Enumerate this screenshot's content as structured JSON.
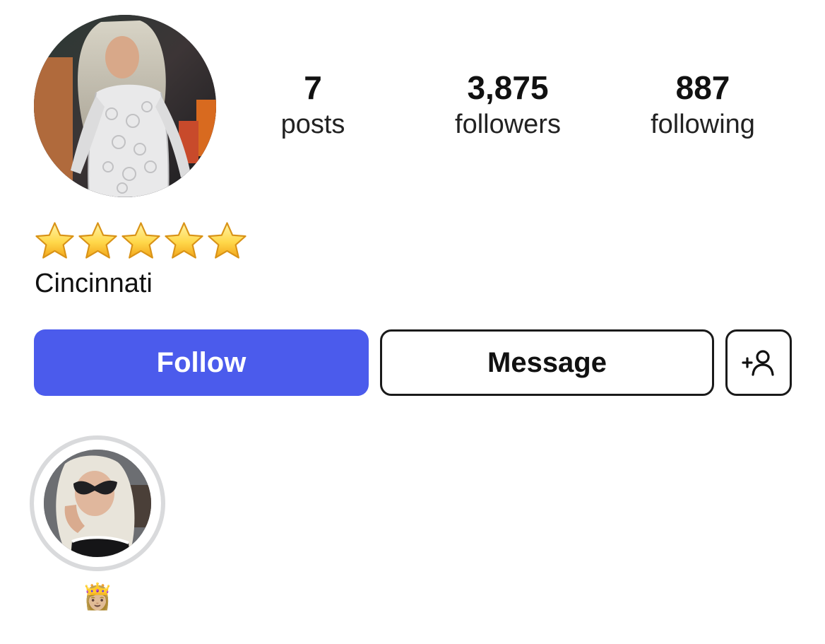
{
  "profile": {
    "avatar_icon": "profile-photo",
    "stats": {
      "posts": {
        "value": "7",
        "label": "posts"
      },
      "followers": {
        "value": "3,875",
        "label": "followers"
      },
      "following": {
        "value": "887",
        "label": "following"
      }
    },
    "rating_stars": 5,
    "location": "Cincinnati"
  },
  "actions": {
    "follow_label": "Follow",
    "message_label": "Message",
    "add_icon": "add-person-icon",
    "follow_color": "#4b5bec"
  },
  "highlights": [
    {
      "label": "👸🏼"
    }
  ]
}
